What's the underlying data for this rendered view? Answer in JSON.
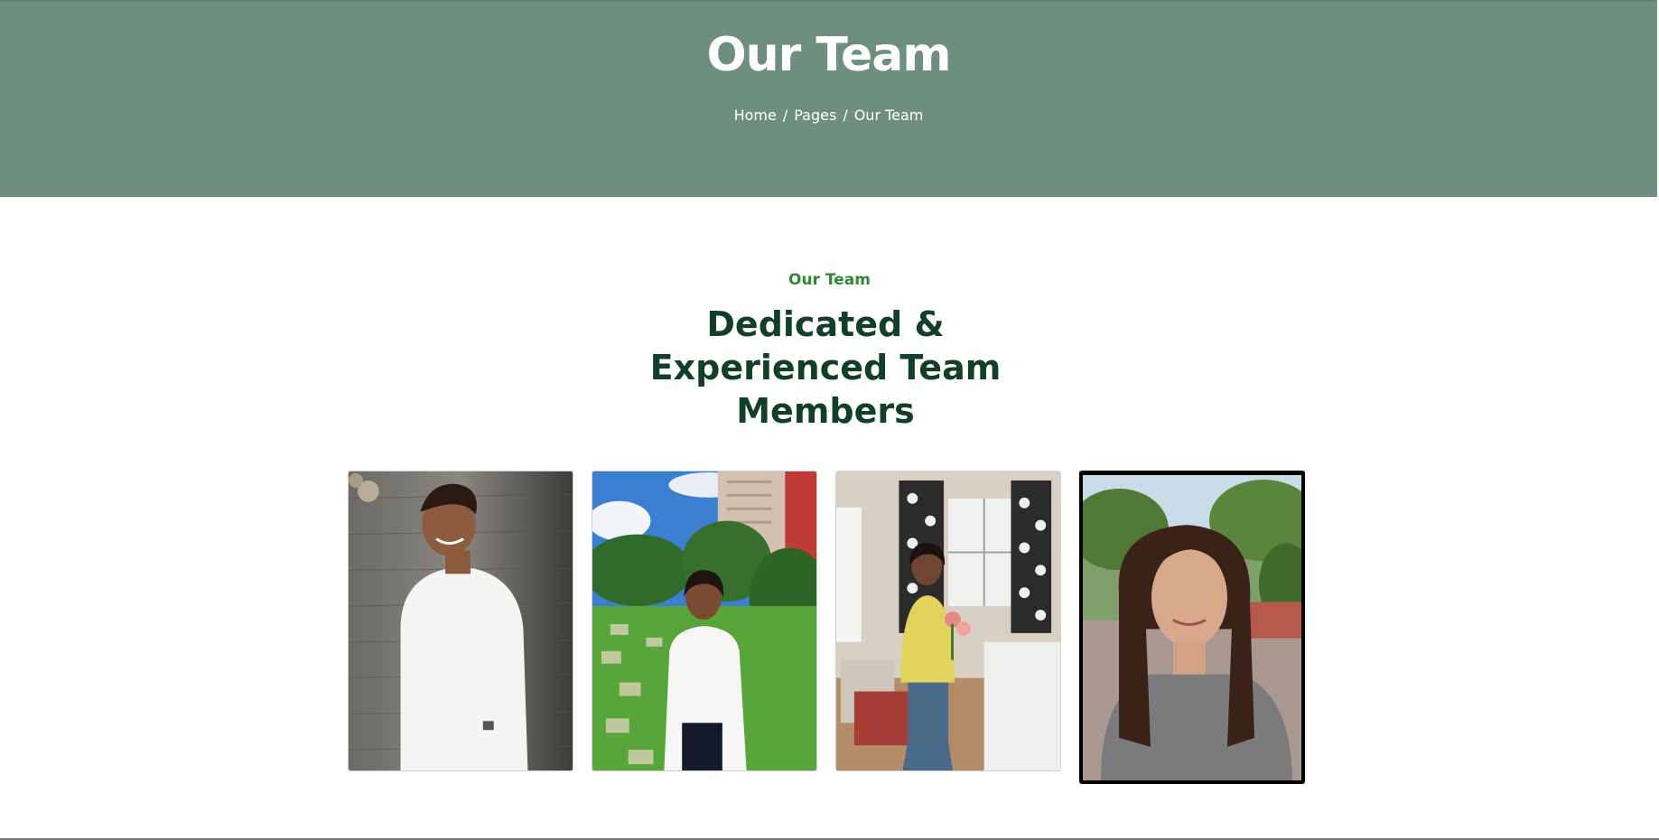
{
  "hero": {
    "title": "Our Team",
    "breadcrumb": {
      "home": "Home",
      "pages": "Pages",
      "current": "Our Team",
      "separator": "/"
    },
    "background_color": "#6e8e80"
  },
  "section": {
    "eyebrow": "Our Team",
    "heading": "Dedicated & Experienced Team Members",
    "eyebrow_color": "#2f8a2f",
    "heading_color": "#123f2a"
  },
  "team_members": [
    {
      "photo": "man-white-shirt-against-wood-wall"
    },
    {
      "photo": "woman-white-top-in-garden"
    },
    {
      "photo": "woman-yellow-top-holding-flowers-indoors"
    },
    {
      "photo": "woman-long-hair-selfie-outdoors"
    }
  ]
}
